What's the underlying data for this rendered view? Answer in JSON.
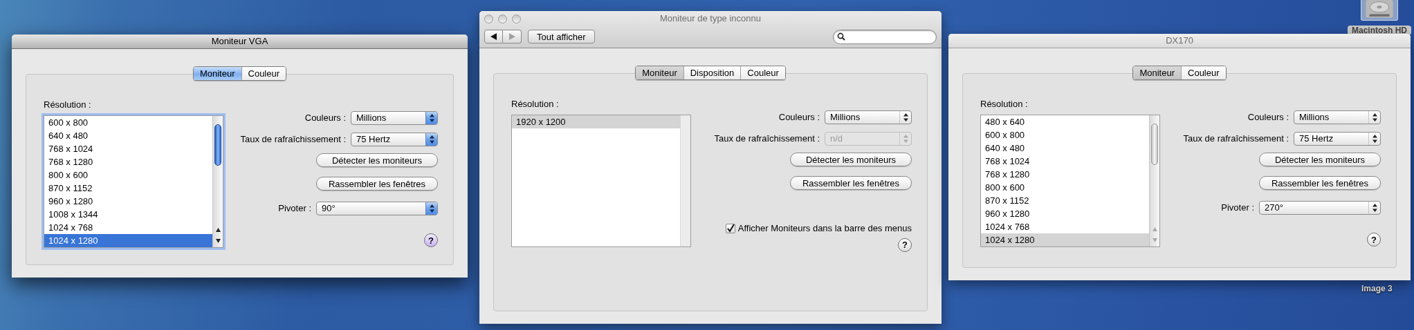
{
  "desktop_icons": [
    {
      "kind": "disk",
      "label": "Macintosh HD",
      "selected": true
    },
    {
      "kind": "file",
      "label": "Image 3",
      "selected": false
    }
  ],
  "windows": [
    {
      "title": "Moniteur VGA",
      "focused": true,
      "tabs": [
        {
          "label": "Moniteur",
          "selected": true
        },
        {
          "label": "Couleur",
          "selected": false
        }
      ],
      "resolution": {
        "label": "Résolution :",
        "scrollbar": true,
        "items": [
          {
            "text": "600 x 800",
            "selected": false
          },
          {
            "text": "640 x 480",
            "selected": false
          },
          {
            "text": "768 x 1024",
            "selected": false
          },
          {
            "text": "768 x 1280",
            "selected": false
          },
          {
            "text": "800 x 600",
            "selected": false
          },
          {
            "text": "870 x 1152",
            "selected": false
          },
          {
            "text": "960 x 1280",
            "selected": false
          },
          {
            "text": "1008 x 1344",
            "selected": false
          },
          {
            "text": "1024 x 768",
            "selected": false
          },
          {
            "text": "1024 x 1280",
            "selected": true
          }
        ]
      },
      "settings": [
        {
          "kind": "select",
          "label": "Couleurs :",
          "value": "Millions",
          "disabled": false
        },
        {
          "kind": "select",
          "label": "Taux de rafraîchissement :",
          "value": "75 Hertz",
          "disabled": false
        },
        {
          "kind": "button",
          "label": "Détecter les moniteurs"
        },
        {
          "kind": "button",
          "label": "Rassembler les fenêtres"
        },
        {
          "kind": "wide_select",
          "label": "Pivoter :",
          "value": "90°",
          "disabled": false
        }
      ],
      "help": "?"
    },
    {
      "title": "Moniteur de type inconnu",
      "focused": false,
      "toolbar": {
        "nav": [
          {
            "kind": "back",
            "disabled": false
          },
          {
            "kind": "forward",
            "disabled": true
          }
        ],
        "show_all": "Tout afficher"
      },
      "tabs": [
        {
          "label": "Moniteur",
          "selected": true
        },
        {
          "label": "Disposition",
          "selected": false
        },
        {
          "label": "Couleur",
          "selected": false
        }
      ],
      "resolution": {
        "label": "Résolution :",
        "scrollbar": false,
        "items": [
          {
            "text": "1920 x 1200",
            "selected": true
          }
        ]
      },
      "settings": [
        {
          "kind": "select",
          "label": "Couleurs :",
          "value": "Millions",
          "disabled": false
        },
        {
          "kind": "select",
          "label": "Taux de rafraîchissement :",
          "value": "n/d",
          "disabled": true
        },
        {
          "kind": "button",
          "label": "Détecter les moniteurs"
        },
        {
          "kind": "button",
          "label": "Rassembler les fenêtres"
        },
        {
          "kind": "checkbox",
          "label": "Afficher Moniteurs dans la barre des menus",
          "checked": true
        }
      ],
      "help": "?"
    },
    {
      "title": "DX170",
      "focused": false,
      "tabs": [
        {
          "label": "Moniteur",
          "selected": true
        },
        {
          "label": "Couleur",
          "selected": false
        }
      ],
      "resolution": {
        "label": "Résolution :",
        "scrollbar": true,
        "items": [
          {
            "text": "480 x 640",
            "selected": false
          },
          {
            "text": "600 x 800",
            "selected": false
          },
          {
            "text": "640 x 480",
            "selected": false
          },
          {
            "text": "768 x 1024",
            "selected": false
          },
          {
            "text": "768 x 1280",
            "selected": false
          },
          {
            "text": "800 x 600",
            "selected": false
          },
          {
            "text": "870 x 1152",
            "selected": false
          },
          {
            "text": "960 x 1280",
            "selected": false
          },
          {
            "text": "1024 x 768",
            "selected": false
          },
          {
            "text": "1024 x 1280",
            "selected": true
          }
        ]
      },
      "settings": [
        {
          "kind": "select",
          "label": "Couleurs :",
          "value": "Millions",
          "disabled": false
        },
        {
          "kind": "select",
          "label": "Taux de rafraîchissement :",
          "value": "75 Hertz",
          "disabled": false
        },
        {
          "kind": "button",
          "label": "Détecter les moniteurs"
        },
        {
          "kind": "button",
          "label": "Rassembler les fenêtres"
        },
        {
          "kind": "wide_select",
          "label": "Pivoter :",
          "value": "270°",
          "disabled": false
        }
      ],
      "help": "?"
    }
  ]
}
